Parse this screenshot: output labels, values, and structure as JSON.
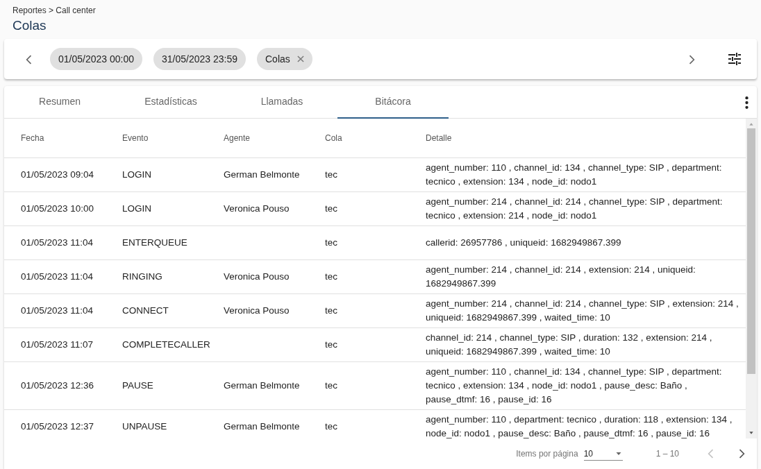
{
  "breadcrumb": "Reportes > Call center",
  "title": "Colas",
  "filters": [
    {
      "label": "01/05/2023 00:00",
      "removable": false
    },
    {
      "label": "31/05/2023 23:59",
      "removable": false
    },
    {
      "label": "Colas",
      "removable": true
    }
  ],
  "tabs": [
    {
      "label": "Resumen",
      "selected": false
    },
    {
      "label": "Estadísticas",
      "selected": false
    },
    {
      "label": "Llamadas",
      "selected": false
    },
    {
      "label": "Bitácora",
      "selected": true
    }
  ],
  "table": {
    "columns": [
      "Fecha",
      "Evento",
      "Agente",
      "Cola",
      "Detalle"
    ],
    "rows": [
      [
        "01/05/2023 09:04",
        "LOGIN",
        "German Belmonte",
        "tec",
        "agent_number: 110 , channel_id: 134 , channel_type: SIP , department: tecnico , extension: 134 , node_id: nodo1"
      ],
      [
        "01/05/2023 10:00",
        "LOGIN",
        "Veronica Pouso",
        "tec",
        "agent_number: 214 , channel_id: 214 , channel_type: SIP , department: tecnico , extension: 214 , node_id: nodo1"
      ],
      [
        "01/05/2023 11:04",
        "ENTERQUEUE",
        "",
        "tec",
        "callerid: 26957786 , uniqueid: 1682949867.399"
      ],
      [
        "01/05/2023 11:04",
        "RINGING",
        "Veronica Pouso",
        "tec",
        "agent_number: 214 , channel_id: 214 , extension: 214 , uniqueid: 1682949867.399"
      ],
      [
        "01/05/2023 11:04",
        "CONNECT",
        "Veronica Pouso",
        "tec",
        "agent_number: 214 , channel_id: 214 , channel_type: SIP , extension: 214 , uniqueid: 1682949867.399 , waited_time: 10"
      ],
      [
        "01/05/2023 11:07",
        "COMPLETECALLER",
        "",
        "tec",
        "channel_id: 214 , channel_type: SIP , duration: 132 , extension: 214 , uniqueid: 1682949867.399 , waited_time: 10"
      ],
      [
        "01/05/2023 12:36",
        "PAUSE",
        "German Belmonte",
        "tec",
        "agent_number: 110 , channel_id: 134 , channel_type: SIP , department: tecnico , extension: 134 , node_id: nodo1 , pause_desc: Baño , pause_dtmf: 16 , pause_id: 16"
      ],
      [
        "01/05/2023 12:37",
        "UNPAUSE",
        "German Belmonte",
        "tec",
        "agent_number: 110 , department: tecnico , duration: 118 , extension: 134 , node_id: nodo1 , pause_desc: Baño , pause_dtmf: 16 , pause_id: 16"
      ]
    ]
  },
  "pagination": {
    "items_per_page_label": "Items por página",
    "page_size": "10",
    "range": "1 – 10",
    "previous_disabled": true,
    "next_disabled": false
  }
}
